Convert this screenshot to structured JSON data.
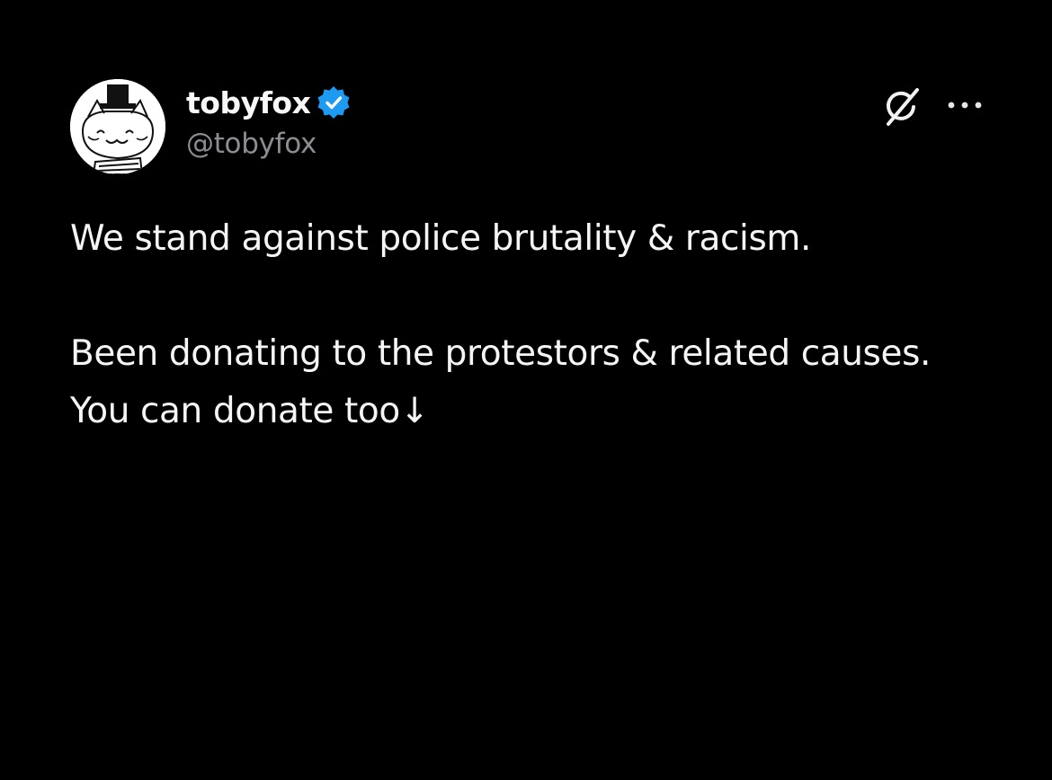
{
  "author": {
    "display_name": "tobyfox",
    "handle": "@tobyfox",
    "verified": true,
    "avatar_icon": "cat-with-top-hat-avatar",
    "verified_color": "#1d9bf0"
  },
  "actions": {
    "grok_icon": "grok-icon",
    "more_icon": "more-options-icon"
  },
  "post": {
    "paragraphs": [
      "We stand against police brutality & racism.",
      "Been donating to the protestors & related causes. You can donate too↓"
    ]
  },
  "colors": {
    "background": "#000000",
    "text": "#f5f5f5",
    "secondary_text": "#8a8d91"
  }
}
